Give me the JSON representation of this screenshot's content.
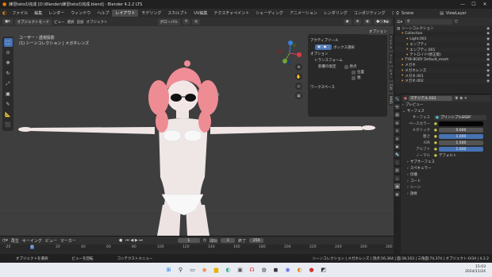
{
  "window": {
    "title": "練習tetoの完成 [D:\\Blender\\練習tetoの完成.blend] - Blender 4.2.2 LTS",
    "controls": [
      "—",
      "☐",
      "✕"
    ]
  },
  "menubar": {
    "menus": [
      "ファイル",
      "編集",
      "レンダー",
      "ウィンドウ",
      "ヘルプ"
    ],
    "workspaces": [
      "レイアウト",
      "モデリング",
      "スカルプト",
      "UV編集",
      "テクスチャペイント",
      "シェーディング",
      "アニメーション",
      "レンダリング",
      "コンポジティング",
      "ジオメトリ"
    ],
    "active_workspace_index": 0
  },
  "topright": {
    "scene_label": "Scene",
    "viewlayer_label": "ViewLayer"
  },
  "viewport_header": {
    "mode": "オブジェクトモード",
    "menus": [
      "ビュー",
      "選択",
      "追加",
      "オブジェクト"
    ],
    "transform": "グローバル",
    "options": "オプション"
  },
  "viewport": {
    "info_line1": "ユーザー・透視投影",
    "info_line2": "(1) シーンコレクション | メガネレンズ"
  },
  "npanel": {
    "active_tool_title": "アクティブツール",
    "select_box": "ボックス選択",
    "options_title": "オプション",
    "transform_title": "トランスフォーム",
    "affect_only": "影響の限定",
    "origins": "原点",
    "locations": "位置",
    "parents": "親",
    "workspace_title": "ワークスペース"
  },
  "side_tabs": [
    "アイテム",
    "ツール",
    "ビュー",
    "Edit",
    "MMD"
  ],
  "outliner": {
    "rows": [
      {
        "label": "シーンコレクション",
        "indent": 0
      },
      {
        "label": "Collection",
        "indent": 1
      },
      {
        "label": "Light.001",
        "indent": 2
      },
      {
        "label": "エンプティ",
        "indent": 2
      },
      {
        "label": "エンプティ.001",
        "indent": 2
      },
      {
        "label": "テトロイド(修正版)",
        "indent": 2
      },
      {
        "label": "TYB BODY Default_mash",
        "indent": 1
      },
      {
        "label": "メガネ",
        "indent": 1
      },
      {
        "label": "メガネレンズ",
        "indent": 1
      },
      {
        "label": "メガネ.001",
        "indent": 1
      },
      {
        "label": "メガネ.002",
        "indent": 1
      }
    ]
  },
  "properties": {
    "material_name": "マテリアル.033",
    "preview": "プレビュー",
    "surface_section": "サーフェス",
    "surface_label": "サーフェス",
    "surface_value": "プリンシプルBSDF",
    "rows": [
      {
        "label": "ベースカラー",
        "value": "",
        "kind": "color"
      },
      {
        "label": "メタリック",
        "value": "0.000",
        "kind": "field"
      },
      {
        "label": "粗さ",
        "value": "1.000",
        "kind": "blue"
      },
      {
        "label": "IOR",
        "value": "1.500",
        "kind": "field"
      },
      {
        "label": "アルファ",
        "value": "1.000",
        "kind": "blue"
      },
      {
        "label": "ノーマル",
        "value": "デフォルト",
        "kind": "plain"
      }
    ],
    "subsections": [
      "サブサーフェス",
      "スペキュラー",
      "伝播",
      "コート",
      "シーン",
      "放射"
    ]
  },
  "timeline": {
    "menus": [
      "再生",
      "キーイング",
      "ビュー",
      "マーカー"
    ],
    "current_frame": "1",
    "start_label": "開始",
    "start": "1",
    "end_label": "終了",
    "end": "250",
    "ruler": [
      "-20",
      "0",
      "20",
      "40",
      "60",
      "80",
      "100",
      "120",
      "140",
      "160",
      "180",
      "200",
      "220",
      "240",
      "260",
      "280"
    ]
  },
  "statusbar": {
    "items": [
      "オブジェクトを選択",
      "ビューを回転",
      "コンテクストメニュー"
    ],
    "right": "シーンコレクション | メガネレンズ | 頂点:56,364 | 面:38,163 | 三角面:74,374 | オブジェクト:0/34 | 4.2.2"
  },
  "taskbar": {
    "time": "15:03",
    "date": "2024/11/24"
  },
  "colors": {
    "accent": "#4772b3",
    "active_tab": "#4a4a4a",
    "viewport_bg": "#3e3e3e"
  }
}
